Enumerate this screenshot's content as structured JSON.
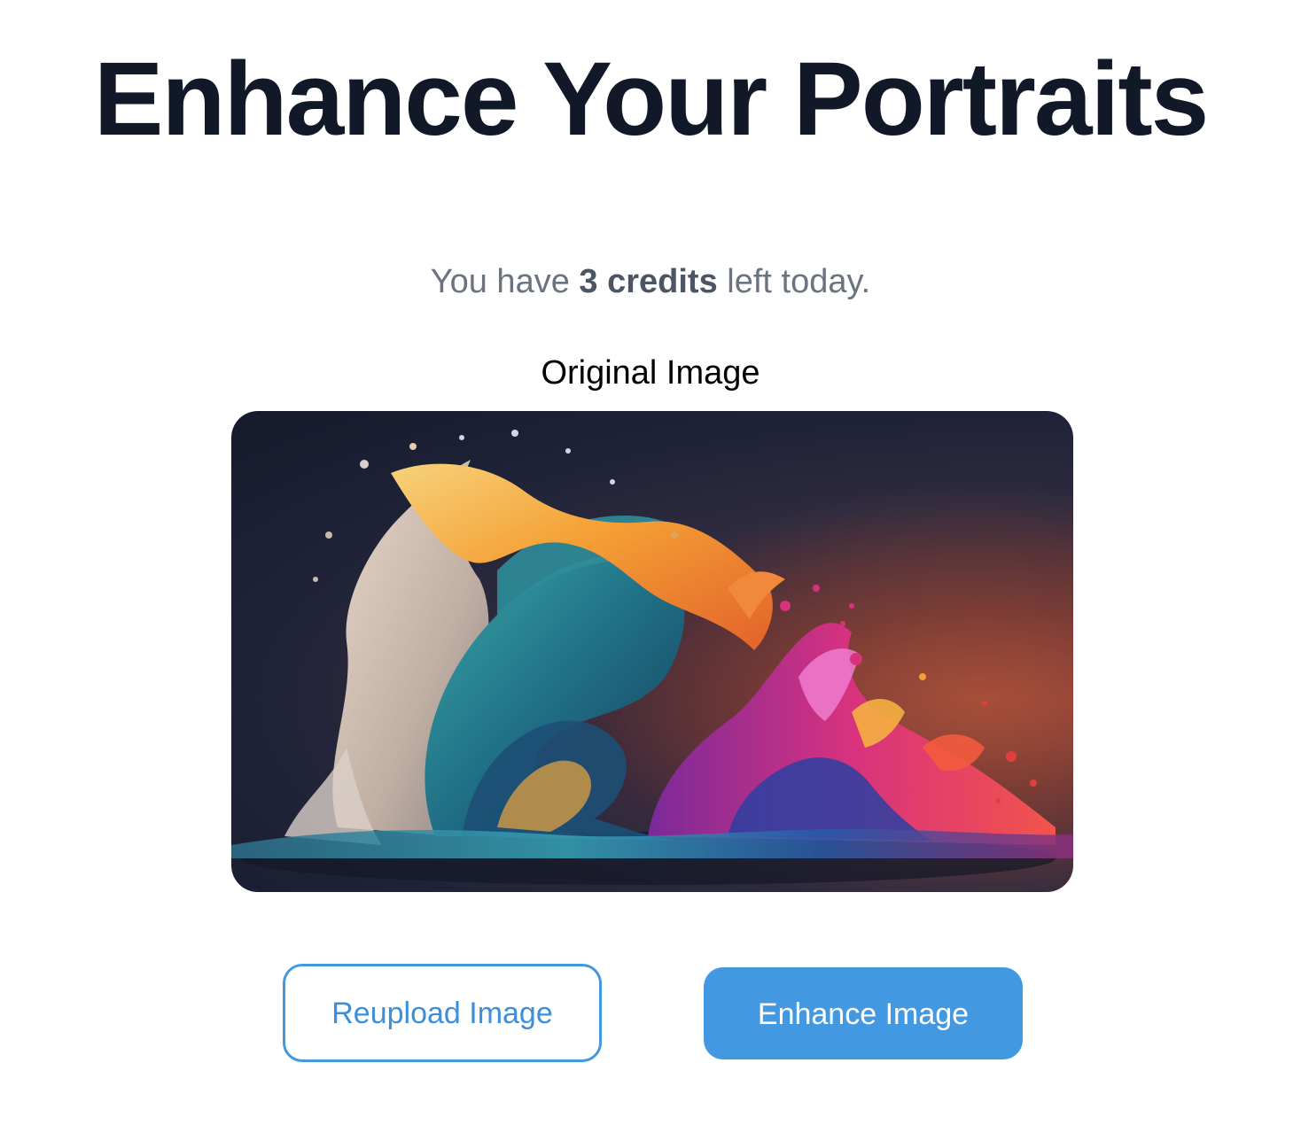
{
  "header": {
    "title": "Enhance Your Portraits"
  },
  "credits": {
    "prefix": "You have ",
    "amount": "3 credits",
    "suffix": " left today."
  },
  "preview": {
    "label": "Original Image",
    "image_description": "colorful paint splash wave"
  },
  "actions": {
    "reupload_label": "Reupload Image",
    "enhance_label": "Enhance Image"
  },
  "colors": {
    "title": "#111827",
    "muted_text": "#6b7280",
    "accent": "#4299e1",
    "button_text_on_accent": "#ffffff"
  }
}
